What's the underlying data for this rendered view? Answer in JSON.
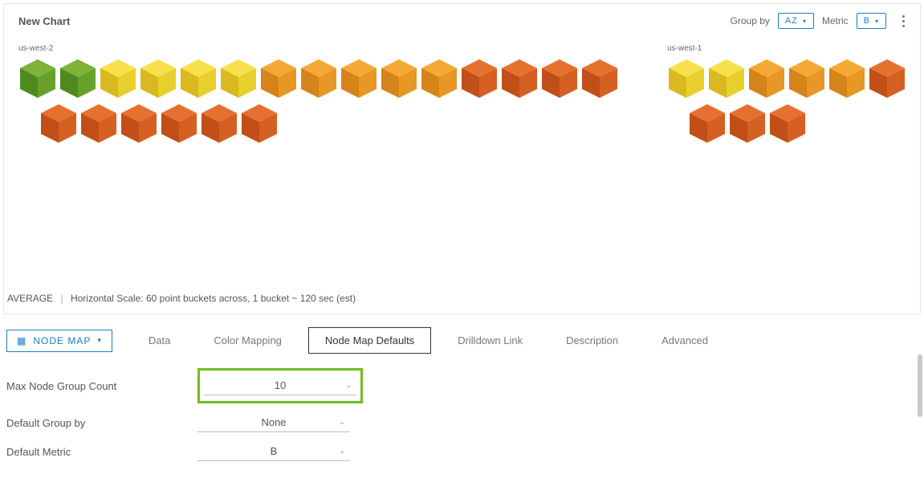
{
  "header": {
    "title": "New Chart",
    "group_by_label": "Group by",
    "group_by_value": "AZ",
    "metric_label": "Metric",
    "metric_value": "B"
  },
  "groups": [
    {
      "label": "us-west-2",
      "rows": [
        [
          "green",
          "green",
          "yellow",
          "yellow",
          "yellow",
          "yellow",
          "amber",
          "amber",
          "amber",
          "amber",
          "amber",
          "dorange",
          "dorange",
          "dorange",
          "dorange"
        ],
        [
          "dorange",
          "dorange",
          "dorange",
          "dorange",
          "dorange",
          "dorange"
        ]
      ]
    },
    {
      "label": "us-west-1",
      "rows": [
        [
          "yellow",
          "yellow",
          "amber",
          "amber",
          "amber",
          "dorange"
        ],
        [
          "dorange",
          "dorange",
          "dorange"
        ]
      ]
    }
  ],
  "footer": {
    "agg": "AVERAGE",
    "scale": "Horizontal Scale: 60 point buckets across, 1 bucket ~ 120 sec (est)"
  },
  "config": {
    "chart_type": "NODE MAP",
    "tabs": [
      "Data",
      "Color Mapping",
      "Node Map Defaults",
      "Drilldown Link",
      "Description",
      "Advanced"
    ],
    "active_tab": "Node Map Defaults",
    "rows": [
      {
        "label": "Max Node Group Count",
        "value": "10",
        "highlight": true
      },
      {
        "label": "Default Group by",
        "value": "None",
        "highlight": false
      },
      {
        "label": "Default Metric",
        "value": "B",
        "highlight": false
      }
    ]
  },
  "colors": {
    "green": {
      "top": "#7eb338",
      "left": "#4f8a1f",
      "right": "#67a12a"
    },
    "yellow": {
      "top": "#f6e14a",
      "left": "#d9b91f",
      "right": "#e8cf2e"
    },
    "amber": {
      "top": "#f3a934",
      "left": "#d6831a",
      "right": "#e69724"
    },
    "dorange": {
      "top": "#e6712f",
      "left": "#c24f18",
      "right": "#d65f22"
    }
  }
}
